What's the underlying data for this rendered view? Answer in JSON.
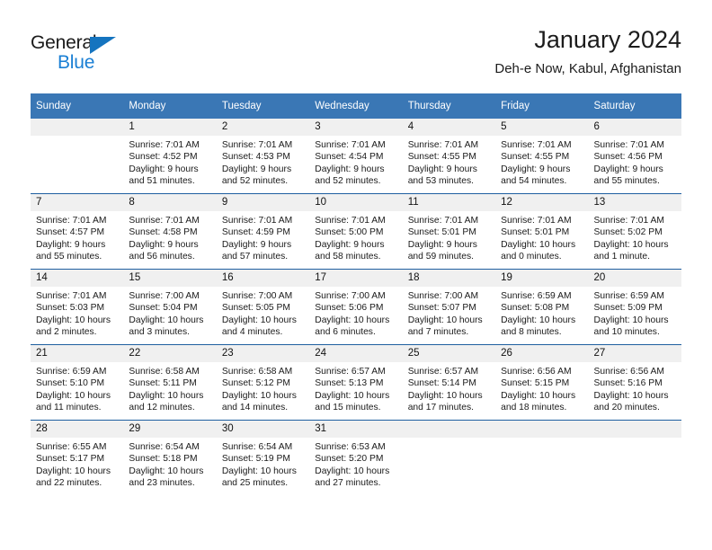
{
  "brand": {
    "name_top": "General",
    "name_bottom": "Blue"
  },
  "header": {
    "title": "January 2024",
    "location": "Deh-e Now, Kabul, Afghanistan"
  },
  "colors": {
    "header_blue": "#3a77b5",
    "separator_blue": "#1f5fa0",
    "daynum_band": "#f0f0f0",
    "logo_blue": "#1a7fd4"
  },
  "weekdays": [
    "Sunday",
    "Monday",
    "Tuesday",
    "Wednesday",
    "Thursday",
    "Friday",
    "Saturday"
  ],
  "weeks": [
    [
      {
        "day": ""
      },
      {
        "day": "1",
        "sunrise": "Sunrise: 7:01 AM",
        "sunset": "Sunset: 4:52 PM",
        "daylight1": "Daylight: 9 hours",
        "daylight2": "and 51 minutes."
      },
      {
        "day": "2",
        "sunrise": "Sunrise: 7:01 AM",
        "sunset": "Sunset: 4:53 PM",
        "daylight1": "Daylight: 9 hours",
        "daylight2": "and 52 minutes."
      },
      {
        "day": "3",
        "sunrise": "Sunrise: 7:01 AM",
        "sunset": "Sunset: 4:54 PM",
        "daylight1": "Daylight: 9 hours",
        "daylight2": "and 52 minutes."
      },
      {
        "day": "4",
        "sunrise": "Sunrise: 7:01 AM",
        "sunset": "Sunset: 4:55 PM",
        "daylight1": "Daylight: 9 hours",
        "daylight2": "and 53 minutes."
      },
      {
        "day": "5",
        "sunrise": "Sunrise: 7:01 AM",
        "sunset": "Sunset: 4:55 PM",
        "daylight1": "Daylight: 9 hours",
        "daylight2": "and 54 minutes."
      },
      {
        "day": "6",
        "sunrise": "Sunrise: 7:01 AM",
        "sunset": "Sunset: 4:56 PM",
        "daylight1": "Daylight: 9 hours",
        "daylight2": "and 55 minutes."
      }
    ],
    [
      {
        "day": "7",
        "sunrise": "Sunrise: 7:01 AM",
        "sunset": "Sunset: 4:57 PM",
        "daylight1": "Daylight: 9 hours",
        "daylight2": "and 55 minutes."
      },
      {
        "day": "8",
        "sunrise": "Sunrise: 7:01 AM",
        "sunset": "Sunset: 4:58 PM",
        "daylight1": "Daylight: 9 hours",
        "daylight2": "and 56 minutes."
      },
      {
        "day": "9",
        "sunrise": "Sunrise: 7:01 AM",
        "sunset": "Sunset: 4:59 PM",
        "daylight1": "Daylight: 9 hours",
        "daylight2": "and 57 minutes."
      },
      {
        "day": "10",
        "sunrise": "Sunrise: 7:01 AM",
        "sunset": "Sunset: 5:00 PM",
        "daylight1": "Daylight: 9 hours",
        "daylight2": "and 58 minutes."
      },
      {
        "day": "11",
        "sunrise": "Sunrise: 7:01 AM",
        "sunset": "Sunset: 5:01 PM",
        "daylight1": "Daylight: 9 hours",
        "daylight2": "and 59 minutes."
      },
      {
        "day": "12",
        "sunrise": "Sunrise: 7:01 AM",
        "sunset": "Sunset: 5:01 PM",
        "daylight1": "Daylight: 10 hours",
        "daylight2": "and 0 minutes."
      },
      {
        "day": "13",
        "sunrise": "Sunrise: 7:01 AM",
        "sunset": "Sunset: 5:02 PM",
        "daylight1": "Daylight: 10 hours",
        "daylight2": "and 1 minute."
      }
    ],
    [
      {
        "day": "14",
        "sunrise": "Sunrise: 7:01 AM",
        "sunset": "Sunset: 5:03 PM",
        "daylight1": "Daylight: 10 hours",
        "daylight2": "and 2 minutes."
      },
      {
        "day": "15",
        "sunrise": "Sunrise: 7:00 AM",
        "sunset": "Sunset: 5:04 PM",
        "daylight1": "Daylight: 10 hours",
        "daylight2": "and 3 minutes."
      },
      {
        "day": "16",
        "sunrise": "Sunrise: 7:00 AM",
        "sunset": "Sunset: 5:05 PM",
        "daylight1": "Daylight: 10 hours",
        "daylight2": "and 4 minutes."
      },
      {
        "day": "17",
        "sunrise": "Sunrise: 7:00 AM",
        "sunset": "Sunset: 5:06 PM",
        "daylight1": "Daylight: 10 hours",
        "daylight2": "and 6 minutes."
      },
      {
        "day": "18",
        "sunrise": "Sunrise: 7:00 AM",
        "sunset": "Sunset: 5:07 PM",
        "daylight1": "Daylight: 10 hours",
        "daylight2": "and 7 minutes."
      },
      {
        "day": "19",
        "sunrise": "Sunrise: 6:59 AM",
        "sunset": "Sunset: 5:08 PM",
        "daylight1": "Daylight: 10 hours",
        "daylight2": "and 8 minutes."
      },
      {
        "day": "20",
        "sunrise": "Sunrise: 6:59 AM",
        "sunset": "Sunset: 5:09 PM",
        "daylight1": "Daylight: 10 hours",
        "daylight2": "and 10 minutes."
      }
    ],
    [
      {
        "day": "21",
        "sunrise": "Sunrise: 6:59 AM",
        "sunset": "Sunset: 5:10 PM",
        "daylight1": "Daylight: 10 hours",
        "daylight2": "and 11 minutes."
      },
      {
        "day": "22",
        "sunrise": "Sunrise: 6:58 AM",
        "sunset": "Sunset: 5:11 PM",
        "daylight1": "Daylight: 10 hours",
        "daylight2": "and 12 minutes."
      },
      {
        "day": "23",
        "sunrise": "Sunrise: 6:58 AM",
        "sunset": "Sunset: 5:12 PM",
        "daylight1": "Daylight: 10 hours",
        "daylight2": "and 14 minutes."
      },
      {
        "day": "24",
        "sunrise": "Sunrise: 6:57 AM",
        "sunset": "Sunset: 5:13 PM",
        "daylight1": "Daylight: 10 hours",
        "daylight2": "and 15 minutes."
      },
      {
        "day": "25",
        "sunrise": "Sunrise: 6:57 AM",
        "sunset": "Sunset: 5:14 PM",
        "daylight1": "Daylight: 10 hours",
        "daylight2": "and 17 minutes."
      },
      {
        "day": "26",
        "sunrise": "Sunrise: 6:56 AM",
        "sunset": "Sunset: 5:15 PM",
        "daylight1": "Daylight: 10 hours",
        "daylight2": "and 18 minutes."
      },
      {
        "day": "27",
        "sunrise": "Sunrise: 6:56 AM",
        "sunset": "Sunset: 5:16 PM",
        "daylight1": "Daylight: 10 hours",
        "daylight2": "and 20 minutes."
      }
    ],
    [
      {
        "day": "28",
        "sunrise": "Sunrise: 6:55 AM",
        "sunset": "Sunset: 5:17 PM",
        "daylight1": "Daylight: 10 hours",
        "daylight2": "and 22 minutes."
      },
      {
        "day": "29",
        "sunrise": "Sunrise: 6:54 AM",
        "sunset": "Sunset: 5:18 PM",
        "daylight1": "Daylight: 10 hours",
        "daylight2": "and 23 minutes."
      },
      {
        "day": "30",
        "sunrise": "Sunrise: 6:54 AM",
        "sunset": "Sunset: 5:19 PM",
        "daylight1": "Daylight: 10 hours",
        "daylight2": "and 25 minutes."
      },
      {
        "day": "31",
        "sunrise": "Sunrise: 6:53 AM",
        "sunset": "Sunset: 5:20 PM",
        "daylight1": "Daylight: 10 hours",
        "daylight2": "and 27 minutes."
      },
      {
        "day": ""
      },
      {
        "day": ""
      },
      {
        "day": ""
      }
    ]
  ]
}
